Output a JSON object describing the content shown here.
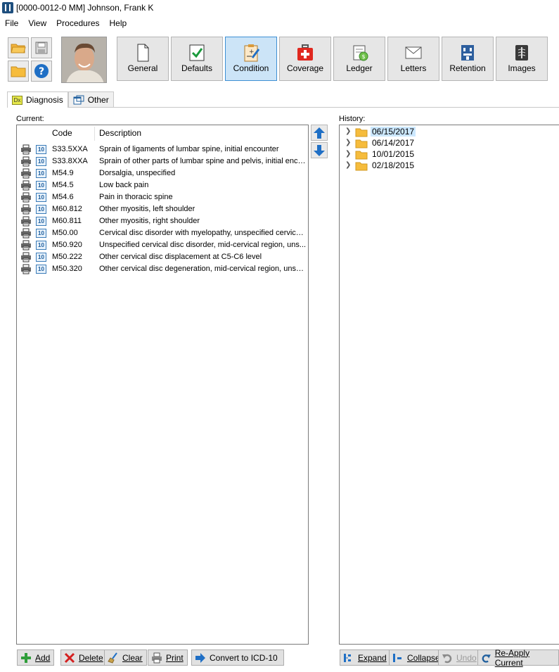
{
  "window": {
    "title": "[0000-0012-0 MM] Johnson, Frank K"
  },
  "menu": [
    "File",
    "View",
    "Procedures",
    "Help"
  ],
  "toolbar": {
    "buttons": [
      {
        "label": "General",
        "icon": "page-icon"
      },
      {
        "label": "Defaults",
        "icon": "check-icon"
      },
      {
        "label": "Condition",
        "icon": "clipboard-icon",
        "active": true
      },
      {
        "label": "Coverage",
        "icon": "first-aid-icon"
      },
      {
        "label": "Ledger",
        "icon": "ledger-icon"
      },
      {
        "label": "Letters",
        "icon": "envelope-icon"
      },
      {
        "label": "Retention",
        "icon": "retention-icon"
      },
      {
        "label": "Images",
        "icon": "xray-icon"
      }
    ]
  },
  "tabs": [
    {
      "label": "Diagnosis",
      "badge": "Dx",
      "active": true
    },
    {
      "label": "Other"
    }
  ],
  "current": {
    "label": "Current:",
    "columns": {
      "code": "Code",
      "description": "Description"
    },
    "icon_badge": "10",
    "rows": [
      {
        "code": "S33.5XXA",
        "description": "Sprain of ligaments of lumbar spine, initial encounter"
      },
      {
        "code": "S33.8XXA",
        "description": "Sprain of other parts of lumbar spine and pelvis, initial enco..."
      },
      {
        "code": "M54.9",
        "description": "Dorsalgia, unspecified"
      },
      {
        "code": "M54.5",
        "description": "Low back pain"
      },
      {
        "code": "M54.6",
        "description": "Pain in thoracic spine"
      },
      {
        "code": "M60.812",
        "description": "Other myositis, left shoulder"
      },
      {
        "code": "M60.811",
        "description": "Other myositis, right shoulder"
      },
      {
        "code": "M50.00",
        "description": "Cervical disc disorder with myelopathy, unspecified cervical..."
      },
      {
        "code": "M50.920",
        "description": "Unspecified cervical disc disorder, mid-cervical region, uns..."
      },
      {
        "code": "M50.222",
        "description": "Other cervical disc displacement at C5-C6 level"
      },
      {
        "code": "M50.320",
        "description": "Other cervical disc degeneration, mid-cervical region, unsp..."
      }
    ]
  },
  "history": {
    "label": "History:",
    "dates": [
      "06/15/2017",
      "06/14/2017",
      "10/01/2015",
      "02/18/2015"
    ]
  },
  "bottom_left": {
    "add": "Add",
    "delete": "Delete",
    "clear": "Clear",
    "print": "Print",
    "convert": "Convert to ICD-10"
  },
  "bottom_right": {
    "expand": "Expand",
    "collapse": "Collapse",
    "undo": "Undo",
    "reapply": "Re-Apply Current"
  },
  "colors": {
    "accent": "#3d8fd4",
    "active_bg": "#cce4f7",
    "arrow_blue": "#1f6fc5"
  }
}
